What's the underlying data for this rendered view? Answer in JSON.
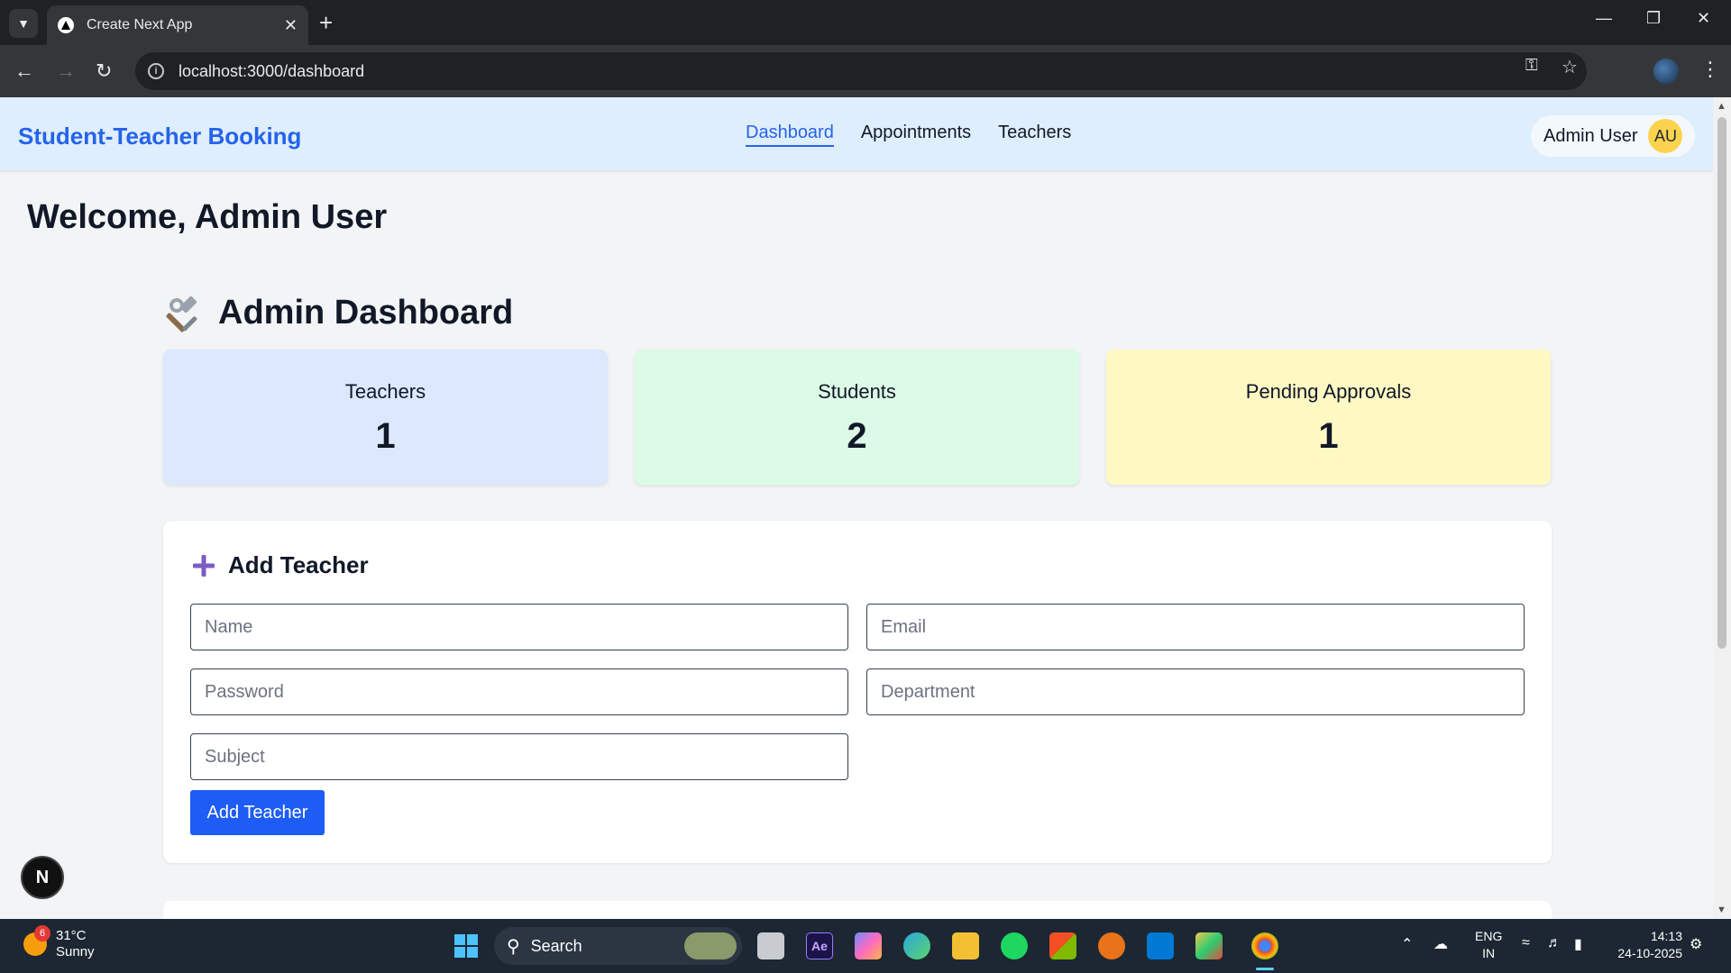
{
  "browser": {
    "tab_title": "Create Next App",
    "url": "localhost:3000/dashboard"
  },
  "app": {
    "brand": "Student-Teacher Booking",
    "nav": [
      "Dashboard",
      "Appointments",
      "Teachers"
    ],
    "active_nav": "Dashboard",
    "user_name": "Admin User",
    "user_initials": "AU"
  },
  "page": {
    "welcome": "Welcome, Admin User",
    "dashboard_title": "Admin Dashboard"
  },
  "stats": [
    {
      "label": "Teachers",
      "value": "1",
      "color": "#dbe8fd"
    },
    {
      "label": "Students",
      "value": "2",
      "color": "#dcfbe7"
    },
    {
      "label": "Pending Approvals",
      "value": "1",
      "color": "#fef8c3"
    }
  ],
  "add_teacher_form": {
    "title": "Add Teacher",
    "name_placeholder": "Name",
    "email_placeholder": "Email",
    "password_placeholder": "Password",
    "department_placeholder": "Department",
    "subject_placeholder": "Subject",
    "submit_label": "Add Teacher"
  },
  "next_badge": "N",
  "taskbar": {
    "weather_temp": "31°C",
    "weather_desc": "Sunny",
    "weather_badge": "6",
    "search_label": "Search",
    "lang_line1": "ENG",
    "lang_line2": "IN",
    "time": "14:13",
    "date": "24-10-2025"
  },
  "colors": {
    "accent": "#2563eb",
    "button": "#1d5cf5",
    "nav_bg": "#dfeefc",
    "page_bg": "#f3f4f6",
    "avatar_bg": "#fcd34d"
  }
}
